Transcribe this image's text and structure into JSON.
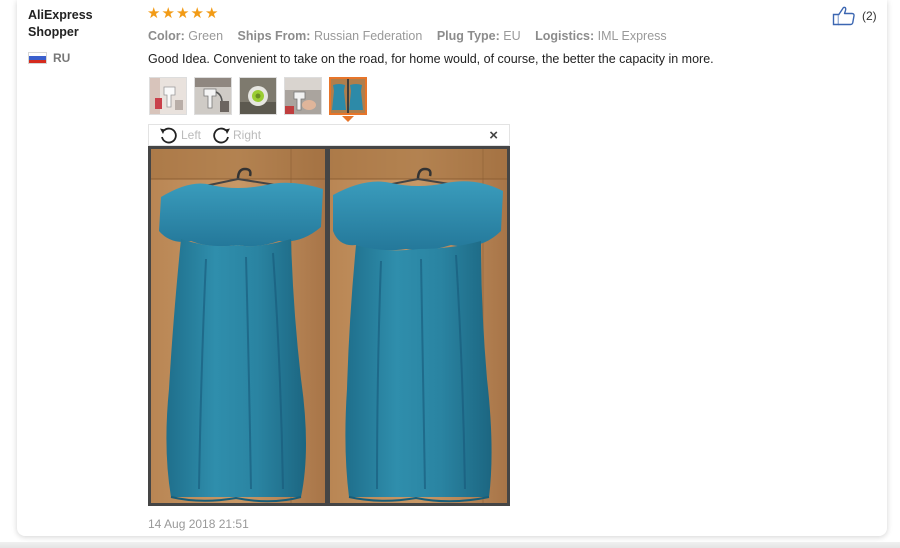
{
  "reviewer": {
    "name": "AliExpress Shopper",
    "country_code": "RU",
    "flag_colors": [
      "#ffffff",
      "#3a5fcd",
      "#d52b1e"
    ]
  },
  "rating": {
    "stars": 5,
    "max": 5,
    "star_glyph": "★",
    "color": "#f29b16"
  },
  "attributes": [
    {
      "label": "Color:",
      "value": "Green"
    },
    {
      "label": "Ships From:",
      "value": "Russian Federation"
    },
    {
      "label": "Plug Type:",
      "value": "EU"
    },
    {
      "label": "Logistics:",
      "value": "IML Express"
    }
  ],
  "review_text": "Good Idea. Convenient to take on the road, for home would, of course, the better the capacity in more.",
  "helpful": {
    "icon": "thumbs-up-icon",
    "count": "(2)"
  },
  "thumbnails": [
    {
      "name": "thumbnail-steamer-red",
      "active": false
    },
    {
      "name": "thumbnail-steamer-hanging",
      "active": false
    },
    {
      "name": "thumbnail-steamer-green",
      "active": false
    },
    {
      "name": "thumbnail-steamer-hand",
      "active": false
    },
    {
      "name": "thumbnail-dresses",
      "active": true
    }
  ],
  "viewer": {
    "rotate_left_label": "Left",
    "rotate_right_label": "Right",
    "close_glyph": "×"
  },
  "date": "14 Aug 2018 21:51",
  "accent_color": "#e7752a"
}
